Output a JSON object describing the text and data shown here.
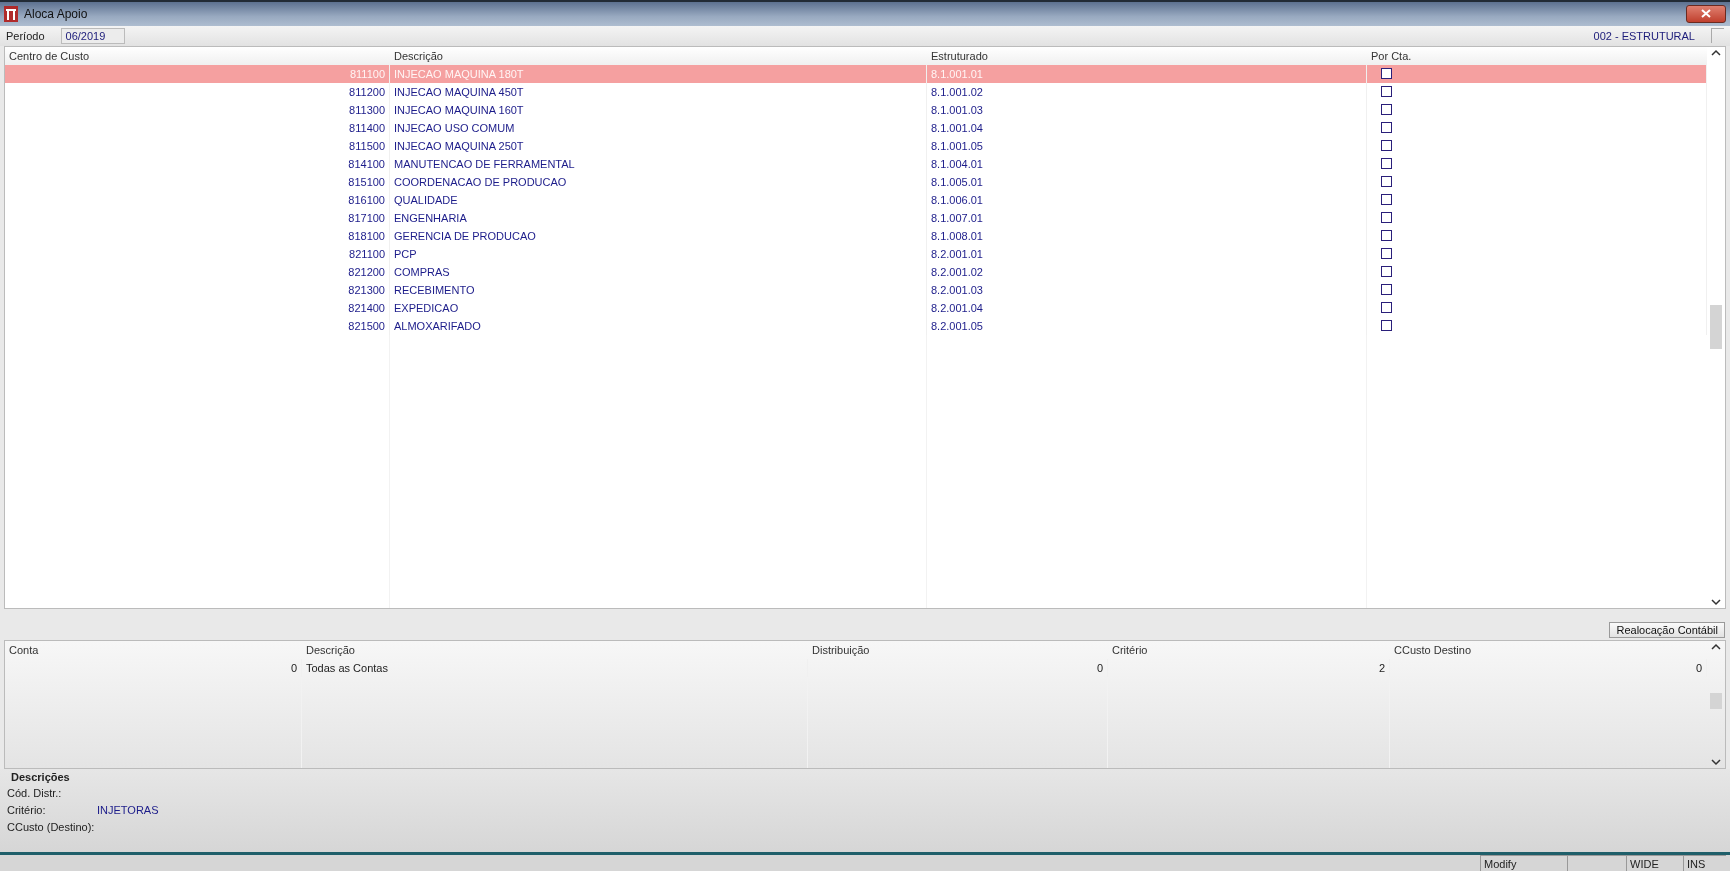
{
  "window": {
    "title": "Aloca Apoio"
  },
  "period": {
    "label": "Período",
    "value": "06/2019"
  },
  "structure_label": "002 - ESTRUTURAL",
  "cost_centers": {
    "columns": [
      "Centro de Custo",
      "Descrição",
      "Estruturado",
      "Por Cta."
    ],
    "rows": [
      {
        "code": "811100",
        "description": "INJECAO MAQUINA 180T",
        "structure": "8.1.001.01",
        "checked": false,
        "selected": true
      },
      {
        "code": "811200",
        "description": "INJECAO MAQUINA 450T",
        "structure": "8.1.001.02",
        "checked": false,
        "selected": false
      },
      {
        "code": "811300",
        "description": "INJECAO MAQUINA 160T",
        "structure": "8.1.001.03",
        "checked": false,
        "selected": false
      },
      {
        "code": "811400",
        "description": "INJECAO USO COMUM",
        "structure": "8.1.001.04",
        "checked": false,
        "selected": false
      },
      {
        "code": "811500",
        "description": "INJECAO MAQUINA 250T",
        "structure": "8.1.001.05",
        "checked": false,
        "selected": false
      },
      {
        "code": "814100",
        "description": "MANUTENCAO DE FERRAMENTAL",
        "structure": "8.1.004.01",
        "checked": false,
        "selected": false
      },
      {
        "code": "815100",
        "description": "COORDENACAO DE PRODUCAO",
        "structure": "8.1.005.01",
        "checked": false,
        "selected": false
      },
      {
        "code": "816100",
        "description": "QUALIDADE",
        "structure": "8.1.006.01",
        "checked": false,
        "selected": false
      },
      {
        "code": "817100",
        "description": "ENGENHARIA",
        "structure": "8.1.007.01",
        "checked": false,
        "selected": false
      },
      {
        "code": "818100",
        "description": "GERENCIA DE PRODUCAO",
        "structure": "8.1.008.01",
        "checked": false,
        "selected": false
      },
      {
        "code": "821100",
        "description": "PCP",
        "structure": "8.2.001.01",
        "checked": false,
        "selected": false
      },
      {
        "code": "821200",
        "description": "COMPRAS",
        "structure": "8.2.001.02",
        "checked": false,
        "selected": false
      },
      {
        "code": "821300",
        "description": "RECEBIMENTO",
        "structure": "8.2.001.03",
        "checked": false,
        "selected": false
      },
      {
        "code": "821400",
        "description": "EXPEDICAO",
        "structure": "8.2.001.04",
        "checked": false,
        "selected": false
      },
      {
        "code": "821500",
        "description": "ALMOXARIFADO",
        "structure": "8.2.001.05",
        "checked": false,
        "selected": false
      }
    ]
  },
  "realloc_button": "Realocação Contábil",
  "accounts": {
    "columns": [
      "Conta",
      "Descrição",
      "Distribuição",
      "Critério",
      "CCusto Destino"
    ],
    "rows": [
      {
        "cells": [
          "0",
          "Todas as Contas",
          "0",
          "2",
          "0"
        ]
      }
    ]
  },
  "descriptions": {
    "title": "Descrições",
    "fields": [
      {
        "label": "Cód. Distr.:"
      },
      {
        "label": "Critério:",
        "value": "INJETORAS"
      },
      {
        "label": "CCusto (Destino):"
      }
    ]
  },
  "status_bar": [
    "Modify",
    "WIDE",
    "INS"
  ]
}
